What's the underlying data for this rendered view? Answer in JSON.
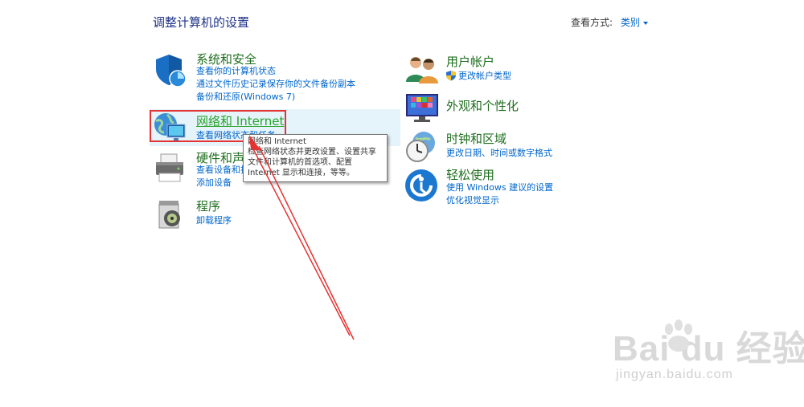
{
  "header": {
    "title": "调整计算机的设置",
    "view_by_label": "查看方式:",
    "view_by_value": "类别"
  },
  "categories": {
    "system": {
      "title": "系统和安全",
      "links": [
        "查看你的计算机状态",
        "通过文件历史记录保存你的文件备份副本",
        "备份和还原(Windows 7)"
      ]
    },
    "network": {
      "title": "网络和 Internet",
      "links": [
        "查看网络状态和任务"
      ]
    },
    "hardware": {
      "title": "硬件和声音",
      "links": [
        "查看设备和打印机",
        "添加设备"
      ]
    },
    "programs": {
      "title": "程序",
      "links": [
        "卸载程序"
      ]
    },
    "user": {
      "title": "用户帐户",
      "links": [
        "更改帐户类型"
      ]
    },
    "appearance": {
      "title": "外观和个性化",
      "links": []
    },
    "clock": {
      "title": "时钟和区域",
      "links": [
        "更改日期、时间或数字格式"
      ]
    },
    "ease": {
      "title": "轻松使用",
      "links": [
        "使用 Windows 建议的设置",
        "优化视觉显示"
      ]
    }
  },
  "tooltip": {
    "title": "网络和 Internet",
    "lines": [
      "检查网络状态并更改设置、设置共享",
      "文件和计算机的首选项、配置",
      "Internet 显示和连接，等等。"
    ]
  },
  "watermark": {
    "main": "Bai du 经验",
    "sub": "jingyan.baidu.com"
  },
  "colors": {
    "category_title": "#1e6e1e",
    "link": "#0066cc",
    "highlight_box": "#e53333",
    "arrow": "#e53333"
  }
}
